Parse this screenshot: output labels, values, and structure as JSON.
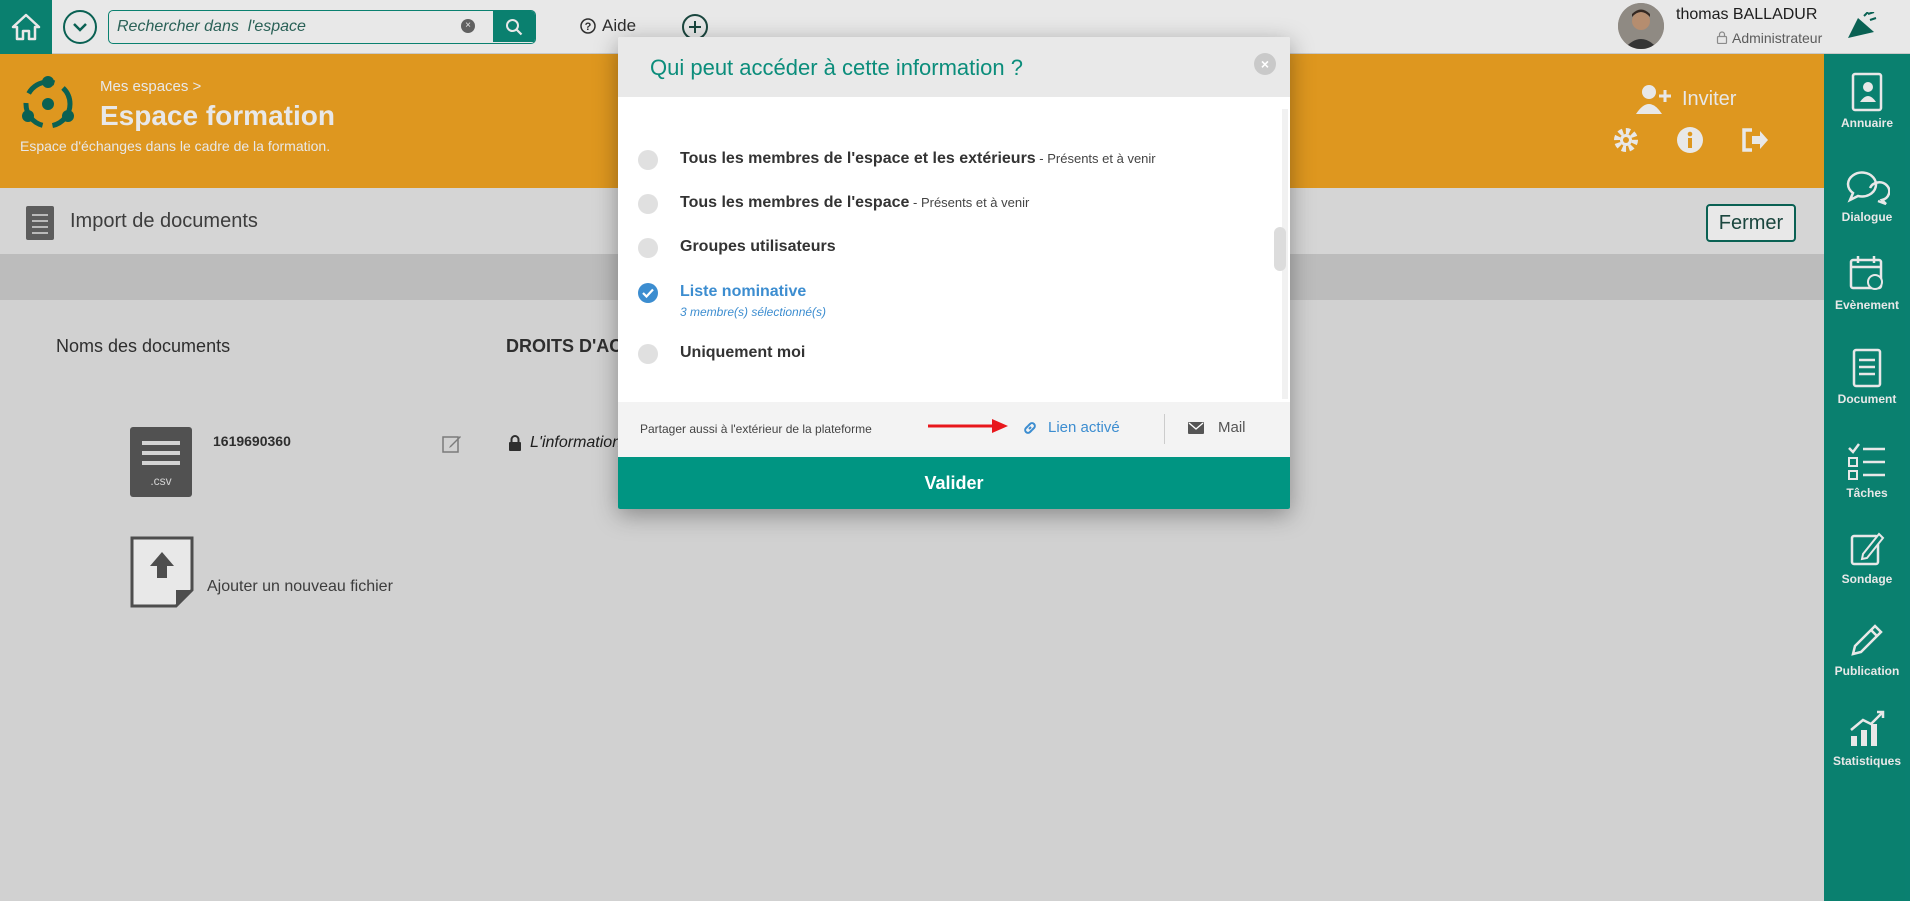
{
  "topbar": {
    "search_placeholder": "Rechercher dans  l'espace",
    "help_label": "Aide",
    "user": {
      "first_name": "thomas",
      "last_name": "BALLADUR",
      "role": "Administrateur"
    }
  },
  "space": {
    "breadcrumb": "Mes espaces >",
    "title": "Espace formation",
    "description": "Espace d'échanges dans le cadre de la formation.",
    "invite_label": "Inviter"
  },
  "sidebar": {
    "items": [
      {
        "label": "Annuaire",
        "icon": "contacts-book-icon"
      },
      {
        "label": "Dialogue",
        "icon": "chat-bubbles-icon"
      },
      {
        "label": "Evènement",
        "icon": "calendar-icon"
      },
      {
        "label": "Document",
        "icon": "document-icon"
      },
      {
        "label": "Tâches",
        "icon": "checklist-icon"
      },
      {
        "label": "Sondage",
        "icon": "poll-icon"
      },
      {
        "label": "Publication",
        "icon": "pencil-icon"
      },
      {
        "label": "Statistiques",
        "icon": "chart-icon"
      }
    ]
  },
  "page": {
    "title": "Import de documents",
    "close_label": "Fermer",
    "col_docs": "Noms des documents",
    "col_rights": "DROITS D'AC",
    "file": {
      "name": "1619690360",
      "ext": ".csv"
    },
    "access_text": "L'information",
    "add_file_label": "Ajouter un nouveau fichier"
  },
  "modal": {
    "title": "Qui peut accéder à cette information ?",
    "options": [
      {
        "label": "Tous les membres de l'espace et les extérieurs",
        "sub": " - Présents et à venir",
        "selected": false
      },
      {
        "label": "Tous les membres de l'espace",
        "sub": " - Présents et à venir",
        "selected": false
      },
      {
        "label": "Groupes utilisateurs",
        "sub": "",
        "selected": false
      },
      {
        "label": "Liste nominative",
        "sub": "",
        "note": "3 membre(s) sélectionné(s)",
        "selected": true
      },
      {
        "label": "Uniquement moi",
        "sub": "",
        "selected": false
      }
    ],
    "share_text": "Partager aussi à l'extérieur de la plateforme",
    "link_label": "Lien activé",
    "mail_label": "Mail",
    "validate_label": "Valider"
  },
  "colors": {
    "primary": "#0b8d7b",
    "header": "#f5a623",
    "accent_blue": "#3c8dd0",
    "validate": "#009582",
    "arrow": "#e8171c"
  }
}
